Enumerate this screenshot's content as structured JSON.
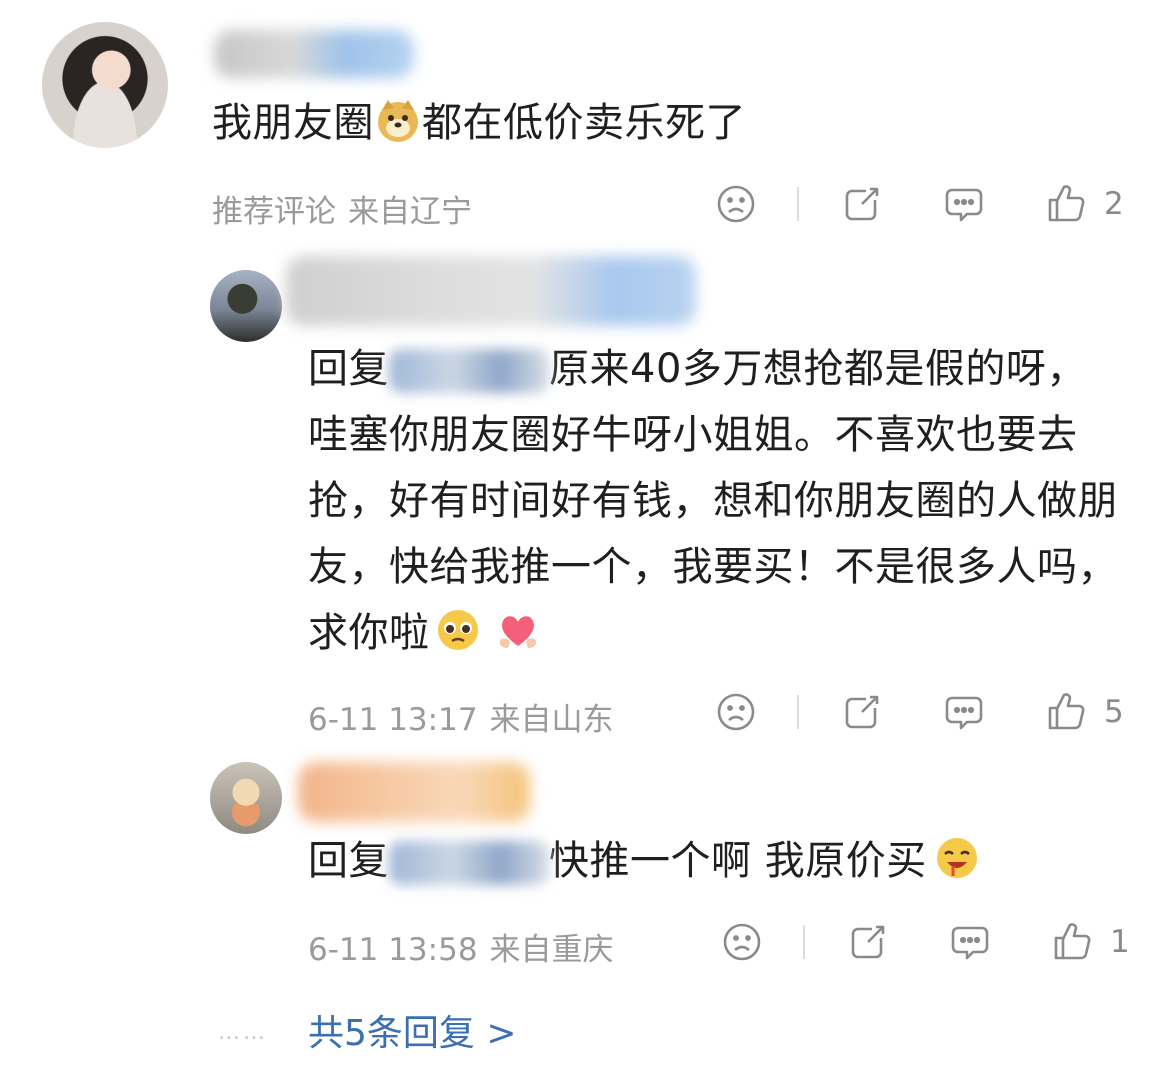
{
  "comments": [
    {
      "text_before": "我朋友圈",
      "text_after": "都在低价卖乐死了",
      "tag": "推荐评论",
      "location": "来自辽宁",
      "like_count": "2"
    },
    {
      "reply_prefix": "回复",
      "text": "原来40多万想抢都是假的呀，哇塞你朋友圈好牛呀小姐姐。不喜欢也要去抢，好有时间好有钱，想和你朋友圈的人做朋友，快给我推一个，我要买！不是很多人吗，求你啦",
      "time": "6-11 13:17",
      "location": "来自山东",
      "like_count": "5"
    },
    {
      "reply_prefix": "回复",
      "text": "快推一个啊 我原价买",
      "time": "6-11 13:58",
      "location": "来自重庆",
      "like_count": "1"
    }
  ],
  "footer": {
    "dots": "……",
    "more_replies": "共5条回复 >"
  },
  "icons": {
    "dislike": "sad-face-icon",
    "share": "share-icon",
    "comment": "comment-icon",
    "like": "thumbs-up-icon"
  },
  "colors": {
    "link": "#3b6fb0",
    "meta": "#9a9a9a"
  }
}
